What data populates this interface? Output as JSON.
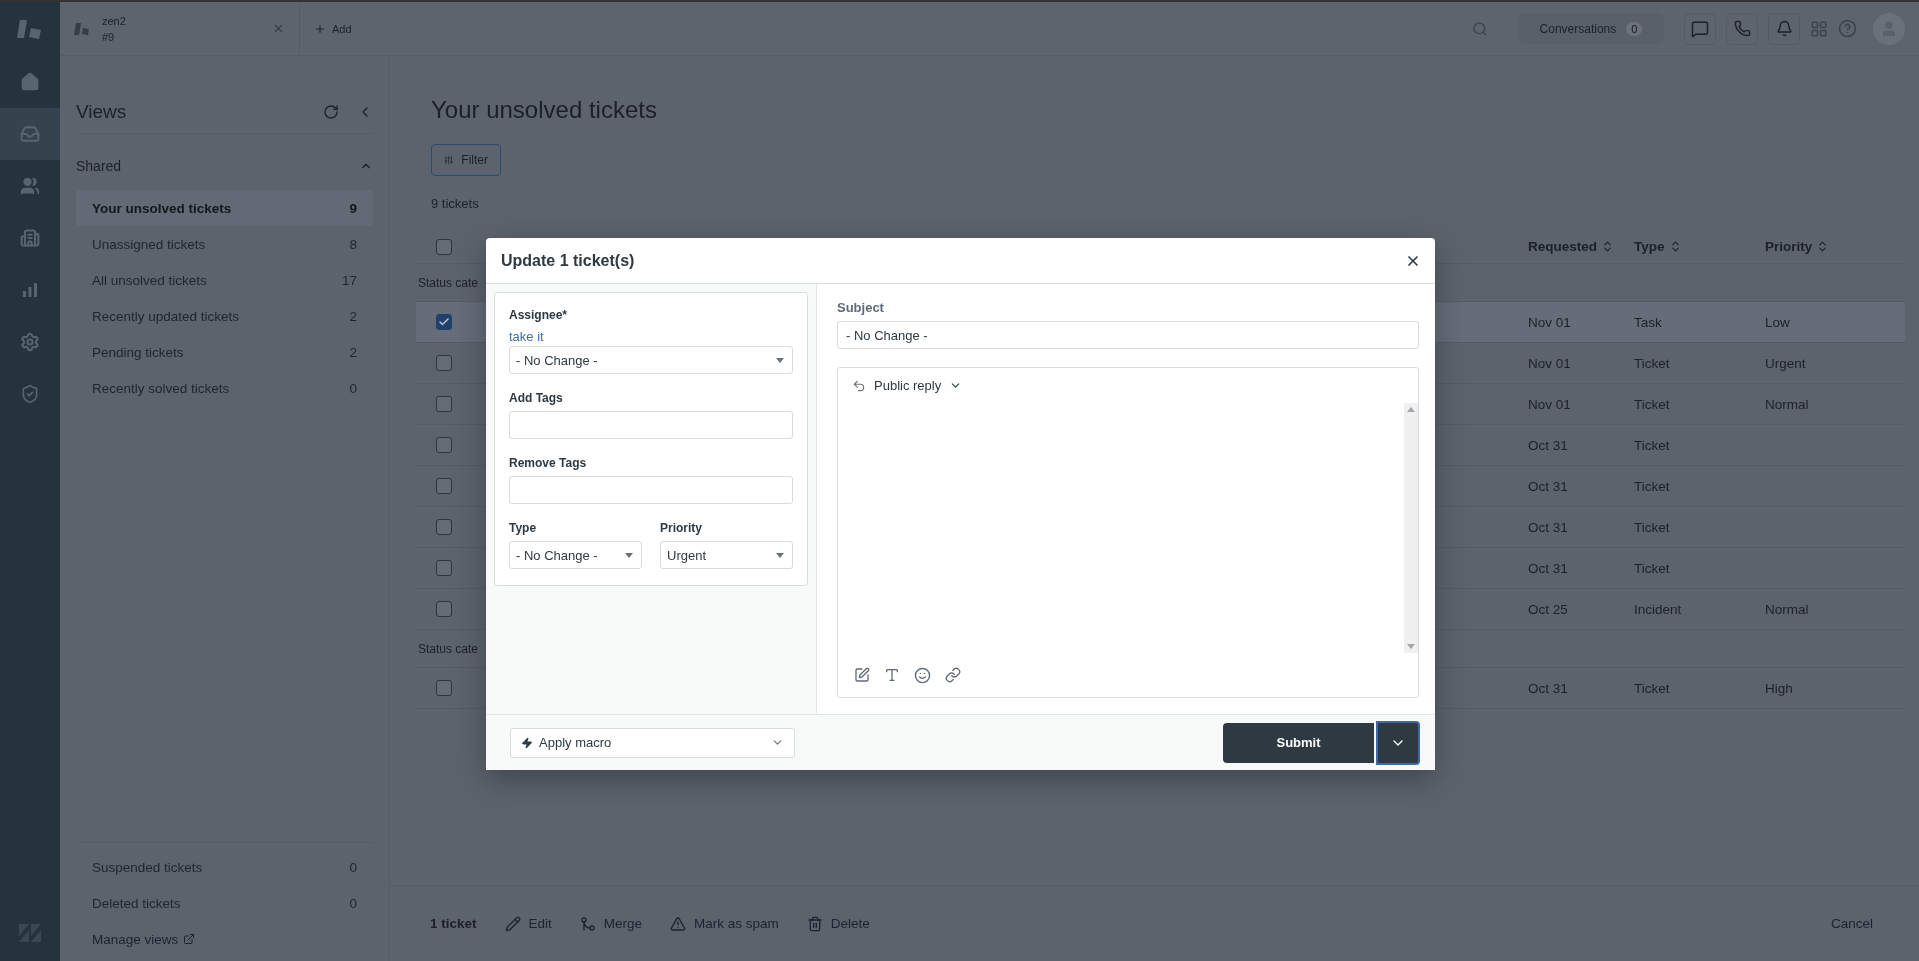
{
  "rail": {
    "items": [
      {
        "kind": "home",
        "selected": false
      },
      {
        "kind": "tickets",
        "selected": true
      },
      {
        "kind": "users",
        "selected": false
      },
      {
        "kind": "organizations",
        "selected": false
      },
      {
        "kind": "reports",
        "selected": false
      },
      {
        "kind": "settings",
        "selected": false
      },
      {
        "kind": "security",
        "selected": false
      }
    ]
  },
  "tabs": [
    {
      "title": "zen2",
      "subtitle": "#9"
    }
  ],
  "add_tab": "Add",
  "topbar": {
    "conversations": "Conversations",
    "conversations_count": "0"
  },
  "views": {
    "title": "Views",
    "section": "Shared",
    "expanded": true,
    "items": [
      {
        "label": "Your unsolved tickets",
        "count": "9",
        "selected": true
      },
      {
        "label": "Unassigned tickets",
        "count": "8",
        "selected": false
      },
      {
        "label": "All unsolved tickets",
        "count": "17",
        "selected": false
      },
      {
        "label": "Recently updated tickets",
        "count": "2",
        "selected": false
      },
      {
        "label": "Pending tickets",
        "count": "2",
        "selected": false
      },
      {
        "label": "Recently solved tickets",
        "count": "0",
        "selected": false
      }
    ],
    "footer_items": [
      {
        "label": "Suspended tickets",
        "count": "0"
      },
      {
        "label": "Deleted tickets",
        "count": "0"
      }
    ],
    "manage": "Manage views"
  },
  "page": {
    "title": "Your unsolved tickets",
    "filter": "Filter",
    "count": "9 tickets"
  },
  "table": {
    "all_checked": false,
    "columns": [
      "Requested",
      "Type",
      "Priority"
    ],
    "groups": [
      {
        "label": "Status cate",
        "rows": [
          {
            "checked": true,
            "requested": "Nov 01",
            "type": "Task",
            "priority": "Low"
          },
          {
            "checked": false,
            "requested": "Nov 01",
            "type": "Ticket",
            "priority": "Urgent"
          },
          {
            "checked": false,
            "requested": "Nov 01",
            "type": "Ticket",
            "priority": "Normal"
          },
          {
            "checked": false,
            "requested": "Oct 31",
            "type": "Ticket"
          },
          {
            "checked": false,
            "requested": "Oct 31",
            "type": "Ticket"
          },
          {
            "checked": false,
            "requested": "Oct 31",
            "type": "Ticket"
          },
          {
            "checked": false,
            "requested": "Oct 31",
            "type": "Ticket"
          },
          {
            "checked": false,
            "requested": "Oct 25",
            "type": "Incident",
            "priority": "Normal"
          }
        ]
      },
      {
        "label": "Status cate",
        "rows": [
          {
            "checked": false,
            "requested": "Oct 31",
            "type": "Ticket",
            "priority": "High"
          }
        ]
      }
    ]
  },
  "bulk_bar": {
    "count": "1 ticket",
    "actions": [
      {
        "kind": "edit",
        "label": "Edit"
      },
      {
        "kind": "merge",
        "label": "Merge"
      },
      {
        "kind": "spam",
        "label": "Mark as spam"
      },
      {
        "kind": "delete",
        "label": "Delete"
      }
    ],
    "cancel": "Cancel"
  },
  "modal": {
    "title": "Update 1 ticket(s)",
    "assignee": {
      "label": "Assignee*",
      "link": "take it",
      "value": "- No Change -"
    },
    "add_tags": {
      "label": "Add Tags"
    },
    "remove_tags": {
      "label": "Remove Tags"
    },
    "type": {
      "label": "Type",
      "value": "- No Change -"
    },
    "priority": {
      "label": "Priority",
      "value": "Urgent"
    },
    "subject": {
      "label": "Subject",
      "value": "- No Change -"
    },
    "reply_mode": "Public reply",
    "macro": "Apply macro",
    "submit": "Submit"
  }
}
